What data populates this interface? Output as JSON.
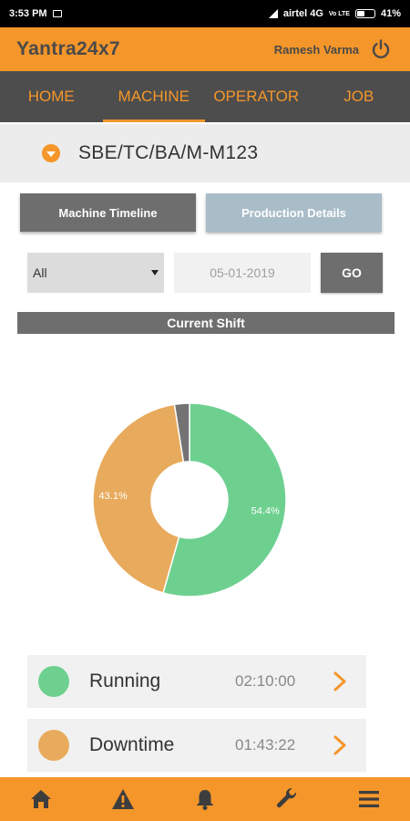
{
  "status_bar": {
    "time": "3:53 PM",
    "carrier": "airtel 4G",
    "volte": "Vo LTE",
    "battery": "41%"
  },
  "app_bar": {
    "title": "Yantra24x7",
    "user_name": "Ramesh Varma"
  },
  "nav": {
    "tabs": [
      {
        "label": "HOME"
      },
      {
        "label": "MACHINE"
      },
      {
        "label": "OPERATOR"
      },
      {
        "label": "JOB"
      }
    ],
    "active_tab": "MACHINE"
  },
  "machine": {
    "name": "SBE/TC/BA/M-M123"
  },
  "view_tabs": {
    "timeline": "Machine Timeline",
    "production": "Production Details"
  },
  "filters": {
    "selected": "All",
    "date": "05-01-2019",
    "go_label": "GO"
  },
  "shift_label": "Current Shift",
  "chart_data": {
    "type": "pie",
    "style": "donut",
    "slices": [
      {
        "value": 54.4,
        "label": "54.4%",
        "color": "#6DD08F"
      },
      {
        "value": 43.1,
        "label": "43.1%",
        "color": "#E8AA5C"
      },
      {
        "value": 2.5,
        "label": "",
        "color": "#737373"
      }
    ]
  },
  "statuses": [
    {
      "name": "Running",
      "time": "02:10:00",
      "color": "#6DD08F"
    },
    {
      "name": "Downtime",
      "time": "01:43:22",
      "color": "#E8AA5C"
    }
  ],
  "colors": {
    "accent": "#F4962A",
    "nav_bg": "#4D4D4D"
  },
  "bottom_nav": {
    "icons": [
      "home-icon",
      "warning-icon",
      "bell-icon",
      "wrench-icon",
      "menu-icon"
    ]
  }
}
